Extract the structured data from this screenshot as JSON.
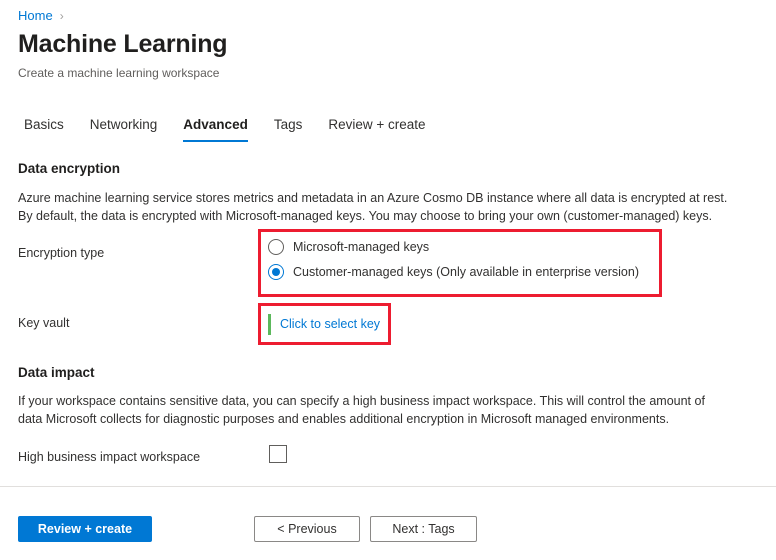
{
  "breadcrumb": {
    "home_label": "Home",
    "separator": "›",
    "separator_icon": "chevron-right-icon"
  },
  "header": {
    "title": "Machine Learning",
    "subtitle": "Create a machine learning workspace"
  },
  "tabs": [
    {
      "label": "Basics",
      "active": false
    },
    {
      "label": "Networking",
      "active": false
    },
    {
      "label": "Advanced",
      "active": true
    },
    {
      "label": "Tags",
      "active": false
    },
    {
      "label": "Review + create",
      "active": false
    }
  ],
  "data_encryption": {
    "heading": "Data encryption",
    "description_line1": "Azure machine learning service stores metrics and metadata in an Azure Cosmo DB instance where all data is encrypted at rest.",
    "description_line2": "By default, the data is encrypted with Microsoft-managed keys. You may choose to bring your own (customer-managed) keys.",
    "encryption_type": {
      "label": "Encryption type",
      "options": [
        {
          "label": "Microsoft-managed keys",
          "selected": false
        },
        {
          "label": "Customer-managed keys (Only available in enterprise version)",
          "selected": true
        }
      ]
    },
    "key_vault": {
      "label": "Key vault",
      "link_label": "Click to select key",
      "required": true
    }
  },
  "data_impact": {
    "heading": "Data impact",
    "description_line1": "If your workspace contains sensitive data, you can specify a high business impact workspace. This will control the amount of",
    "description_line2": "data Microsoft collects for diagnostic purposes and enables additional encryption in Microsoft managed environments.",
    "high_business_impact": {
      "label": "High business impact workspace",
      "checked": false
    }
  },
  "footer": {
    "review_create_label": "Review + create",
    "previous_label": "< Previous",
    "next_label": "Next : Tags"
  },
  "colors": {
    "accent": "#0078d4",
    "highlight": "#ed1c30",
    "required_marker": "#5cb85c",
    "text": "#323130",
    "muted_text": "#605e5c"
  }
}
